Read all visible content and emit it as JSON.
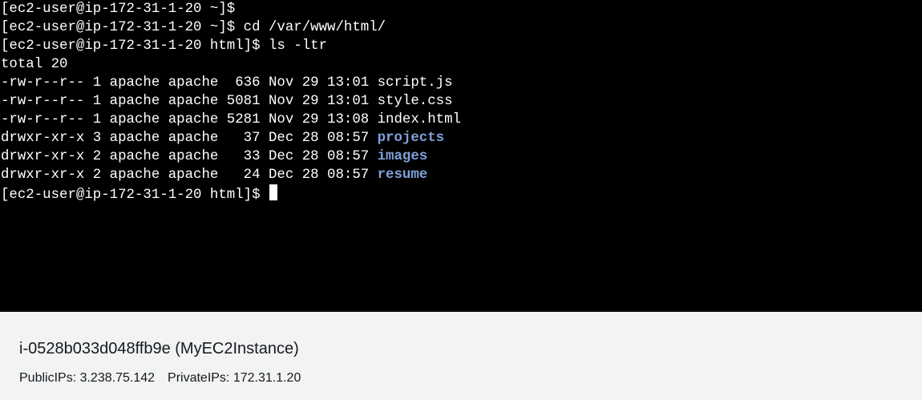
{
  "terminal": {
    "lines": [
      {
        "text": "[ec2-user@ip-172-31-1-20 ~]$"
      },
      {
        "text": "[ec2-user@ip-172-31-1-20 ~]$ cd /var/www/html/"
      },
      {
        "text": "[ec2-user@ip-172-31-1-20 html]$ ls -ltr"
      },
      {
        "text": "total 20"
      },
      {
        "text": "-rw-r--r-- 1 apache apache  636 Nov 29 13:01 ",
        "name": "script.js",
        "is_dir": false
      },
      {
        "text": "-rw-r--r-- 1 apache apache 5081 Nov 29 13:01 ",
        "name": "style.css",
        "is_dir": false
      },
      {
        "text": "-rw-r--r-- 1 apache apache 5281 Nov 29 13:08 ",
        "name": "index.html",
        "is_dir": false
      },
      {
        "text": "drwxr-xr-x 3 apache apache   37 Dec 28 08:57 ",
        "name": "projects",
        "is_dir": true
      },
      {
        "text": "drwxr-xr-x 2 apache apache   33 Dec 28 08:57 ",
        "name": "images",
        "is_dir": true
      },
      {
        "text": "drwxr-xr-x 2 apache apache   24 Dec 28 08:57 ",
        "name": "resume",
        "is_dir": true
      },
      {
        "text": "[ec2-user@ip-172-31-1-20 html]$ ",
        "cursor": true
      }
    ],
    "colors": {
      "background": "#000000",
      "foreground": "#ffffff",
      "directory": "#7fa0d9"
    }
  },
  "instance": {
    "title": "i-0528b033d048ffb9e (MyEC2Instance)",
    "public_ips": "PublicIPs: 3.238.75.142",
    "private_ips": "PrivateIPs: 172.31.1.20"
  }
}
